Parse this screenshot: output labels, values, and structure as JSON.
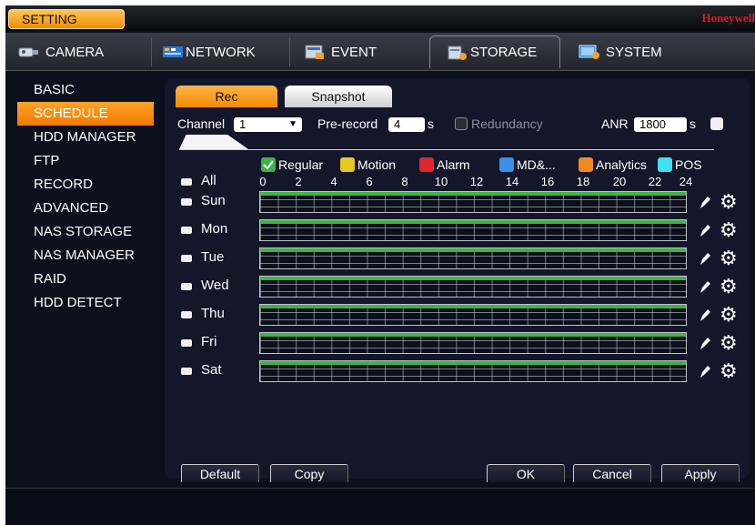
{
  "header": {
    "setting_label": "SETTING",
    "brand": "Honeywell"
  },
  "tabs": [
    {
      "label": "CAMERA",
      "icon": "camera-icon"
    },
    {
      "label": "NETWORK",
      "icon": "network-icon"
    },
    {
      "label": "EVENT",
      "icon": "event-icon"
    },
    {
      "label": "STORAGE",
      "icon": "storage-icon",
      "active": true
    },
    {
      "label": "SYSTEM",
      "icon": "system-icon"
    }
  ],
  "sidebar": {
    "items": [
      {
        "label": "BASIC"
      },
      {
        "label": "SCHEDULE",
        "active": true
      },
      {
        "label": "HDD MANAGER"
      },
      {
        "label": "FTP"
      },
      {
        "label": "RECORD"
      },
      {
        "label": "ADVANCED"
      },
      {
        "label": "NAS STORAGE"
      },
      {
        "label": "NAS MANAGER"
      },
      {
        "label": "RAID"
      },
      {
        "label": "HDD DETECT"
      }
    ]
  },
  "subtabs": {
    "rec": "Rec",
    "snapshot": "Snapshot"
  },
  "controls": {
    "channel_label": "Channel",
    "channel_value": "1",
    "prerecord_label": "Pre-record",
    "prerecord_value": "4",
    "prerecord_unit": "s",
    "redundancy_label": "Redundancy",
    "anr_label": "ANR",
    "anr_value": "1800",
    "anr_unit": "s"
  },
  "legend": [
    {
      "label": "Regular",
      "color": "#3fb24a",
      "checked": true
    },
    {
      "label": "Motion",
      "color": "#e6c81e"
    },
    {
      "label": "Alarm",
      "color": "#e0262e"
    },
    {
      "label": "MD&...",
      "color": "#3d8ee8"
    },
    {
      "label": "Analytics",
      "color": "#f0891e"
    },
    {
      "label": "POS",
      "color": "#3fe0f0"
    }
  ],
  "schedule": {
    "all_label": "All",
    "hours": [
      "0",
      "2",
      "4",
      "6",
      "8",
      "10",
      "12",
      "14",
      "16",
      "18",
      "20",
      "22",
      "24"
    ],
    "days": [
      {
        "label": "Sun",
        "regular_fraction": 1.0
      },
      {
        "label": "Mon",
        "regular_fraction": 1.0
      },
      {
        "label": "Tue",
        "regular_fraction": 1.0
      },
      {
        "label": "Wed",
        "regular_fraction": 1.0
      },
      {
        "label": "Thu",
        "regular_fraction": 1.0
      },
      {
        "label": "Fri",
        "regular_fraction": 1.0
      },
      {
        "label": "Sat",
        "regular_fraction": 1.0
      }
    ]
  },
  "buttons": {
    "default": "Default",
    "copy": "Copy",
    "ok": "OK",
    "cancel": "Cancel",
    "apply": "Apply"
  }
}
